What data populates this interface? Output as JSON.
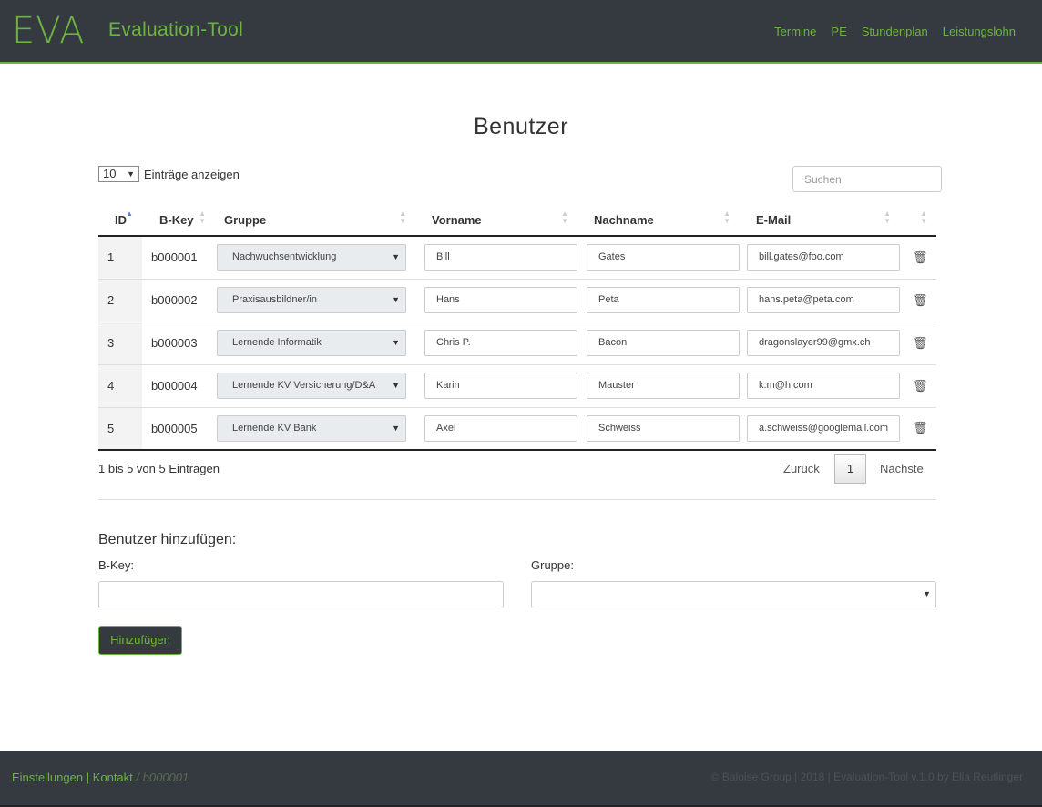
{
  "header": {
    "logo": "EVA",
    "app_title": "Evaluation-Tool",
    "nav": [
      "Termine",
      "PE",
      "Stundenplan",
      "Leistungslohn"
    ]
  },
  "page_title": "Benutzer",
  "table_controls": {
    "length_value": "10",
    "length_label": "Einträge anzeigen",
    "search_placeholder": "Suchen"
  },
  "table": {
    "columns": [
      "ID",
      "B-Key",
      "Gruppe",
      "Vorname",
      "Nachname",
      "E-Mail",
      ""
    ],
    "rows": [
      {
        "id": "1",
        "bkey": "b000001",
        "gruppe": "Nachwuchsentwicklung",
        "vorname": "Bill",
        "nachname": "Gates",
        "email": "bill.gates@foo.com"
      },
      {
        "id": "2",
        "bkey": "b000002",
        "gruppe": "Praxisausbildner/in",
        "vorname": "Hans",
        "nachname": "Peta",
        "email": "hans.peta@peta.com"
      },
      {
        "id": "3",
        "bkey": "b000003",
        "gruppe": "Lernende Informatik",
        "vorname": "Chris P.",
        "nachname": "Bacon",
        "email": "dragonslayer99@gmx.ch"
      },
      {
        "id": "4",
        "bkey": "b000004",
        "gruppe": "Lernende KV Versicherung/D&A",
        "vorname": "Karin",
        "nachname": "Mauster",
        "email": "k.m@h.com"
      },
      {
        "id": "5",
        "bkey": "b000005",
        "gruppe": "Lernende KV Bank",
        "vorname": "Axel",
        "nachname": "Schweiss",
        "email": "a.schweiss@googlemail.com"
      }
    ],
    "info": "1 bis 5 von 5 Einträgen",
    "pager": {
      "prev": "Zurück",
      "page": "1",
      "next": "Nächste"
    }
  },
  "add_user": {
    "title": "Benutzer hinzufügen:",
    "bkey_label": "B-Key:",
    "group_label": "Gruppe:",
    "button": "Hinzufügen"
  },
  "footer": {
    "link_settings": "Einstellungen",
    "link_contact": "Kontakt",
    "user": "b000001",
    "copyright": "© Baloise Group | 2018 | Evaluation-Tool v.1.0 by Elia Reutlinger"
  },
  "colors": {
    "accent": "#6cb33f",
    "dark": "#353a41"
  }
}
